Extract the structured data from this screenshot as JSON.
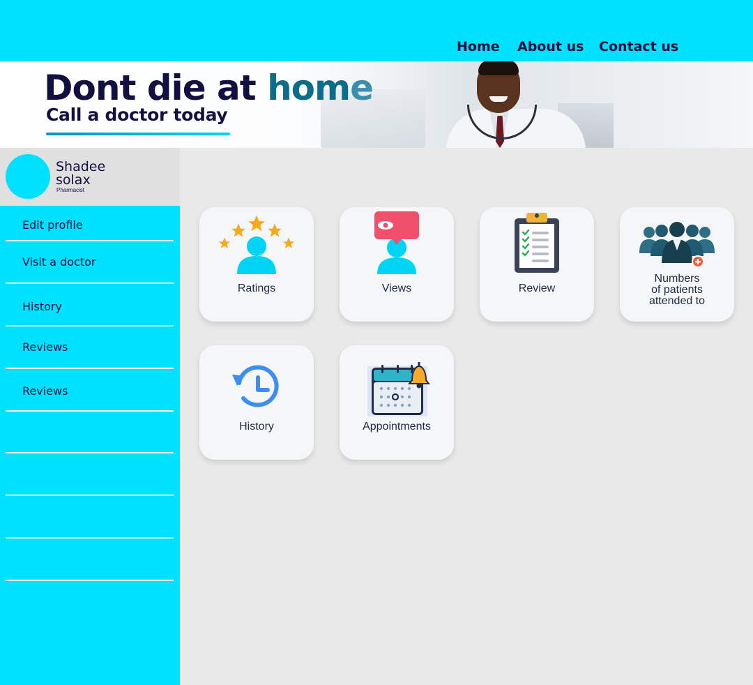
{
  "nav": {
    "home": "Home",
    "about": "About us",
    "contact": "Contact us"
  },
  "banner": {
    "headline_part1": "Dont die at ",
    "headline_part2": "hom",
    "headline_part3": "e",
    "subheadline": "Call a doctor today"
  },
  "profile": {
    "first_name": "Shadee",
    "last_name": "solax",
    "role": "Pharmacist"
  },
  "sidebar": {
    "items": [
      {
        "label": "Edit profile"
      },
      {
        "label": "Visit a doctor"
      },
      {
        "label": "History"
      },
      {
        "label": "Reviews"
      },
      {
        "label": "Reviews"
      }
    ]
  },
  "cards": [
    {
      "label": "Ratings",
      "icon": "ratings-icon"
    },
    {
      "label": "Views",
      "icon": "views-icon"
    },
    {
      "label": "Review",
      "icon": "clipboard-icon"
    },
    {
      "label_line1": "Numbers",
      "label_line2": "of patients",
      "label_line3": "attended to",
      "icon": "patients-group-icon"
    },
    {
      "label": "History",
      "icon": "history-clock-icon"
    },
    {
      "label": "Appointments",
      "icon": "calendar-bell-icon"
    }
  ],
  "colors": {
    "accent": "#00e0ff",
    "navy": "#121040",
    "background": "#e9e9e9",
    "card": "#f5f6f8"
  }
}
